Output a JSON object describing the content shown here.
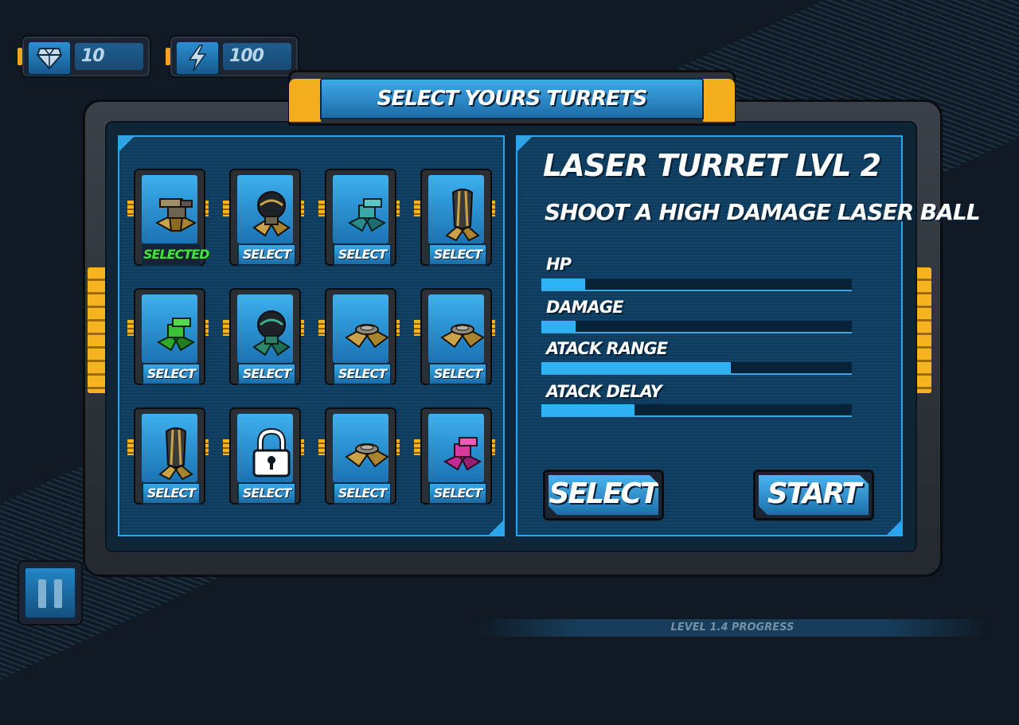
{
  "hud": {
    "gems": {
      "icon": "diamond-icon",
      "value": "10"
    },
    "energy": {
      "icon": "lightning-icon",
      "value": "100"
    }
  },
  "header": {
    "title": "SELECT YOURS TURRETS"
  },
  "turrets": [
    {
      "icon": "gold-cannon-turret-icon",
      "button": "SELECTED",
      "state": "selected"
    },
    {
      "icon": "black-sphere-turret-icon",
      "button": "SELECT",
      "state": "available"
    },
    {
      "icon": "teal-cannon-turret-icon",
      "button": "SELECT",
      "state": "available"
    },
    {
      "icon": "tall-pod-turret-icon",
      "button": "SELECT",
      "state": "available"
    },
    {
      "icon": "green-cannon-turret-icon",
      "button": "SELECT",
      "state": "available"
    },
    {
      "icon": "teal-sphere-turret-icon",
      "button": "SELECT",
      "state": "available"
    },
    {
      "icon": "gold-base-turret-icon",
      "button": "SELECT",
      "state": "available"
    },
    {
      "icon": "gold-base-turret-icon",
      "button": "SELECT",
      "state": "available"
    },
    {
      "icon": "tall-pod-turret-icon",
      "button": "SELECT",
      "state": "available"
    },
    {
      "icon": "padlock-icon",
      "button": "SELECT",
      "state": "locked"
    },
    {
      "icon": "gold-base-turret-icon",
      "button": "SELECT",
      "state": "available"
    },
    {
      "icon": "magenta-cannon-turret-icon",
      "button": "SELECT",
      "state": "available"
    }
  ],
  "details": {
    "name": "LASER TURRET LVL 2",
    "description": "SHOOT A HIGH DAMAGE LASER BALL",
    "stats": [
      {
        "label": "HP",
        "fraction": 0.14
      },
      {
        "label": "DAMAGE",
        "fraction": 0.11
      },
      {
        "label": "ATACK RANGE",
        "fraction": 0.61
      },
      {
        "label": "ATACK DELAY",
        "fraction": 0.3
      }
    ],
    "select_button": "SELECT",
    "start_button": "START"
  },
  "footer": {
    "progress_label": "LEVEL 1.4 PROGRESS"
  },
  "colors": {
    "accent": "#2fb2f3",
    "selected_text": "#41e23c",
    "clip_yellow": "#f4b31f"
  }
}
